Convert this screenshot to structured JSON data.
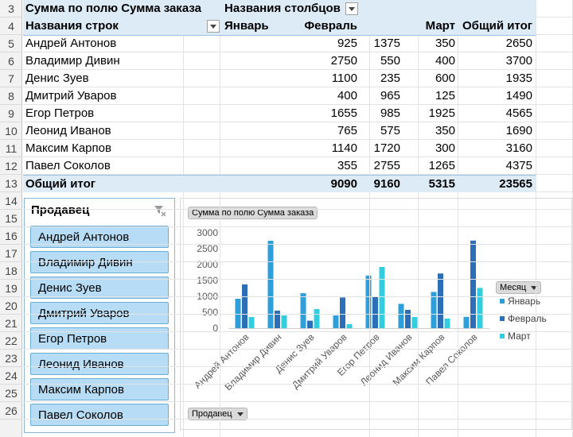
{
  "rows_visible": [
    "3",
    "4",
    "5",
    "6",
    "7",
    "8",
    "9",
    "10",
    "11",
    "12",
    "13",
    "14",
    "15",
    "16",
    "17",
    "18",
    "19",
    "20",
    "21",
    "22",
    "23",
    "24",
    "25",
    "26"
  ],
  "pivot": {
    "values_field": "Сумма по полю Сумма заказа",
    "column_labels": "Названия столбцов",
    "row_labels": "Названия строк",
    "columns": [
      "Январь",
      "Февраль",
      "Март",
      "Общий итог"
    ],
    "rows": [
      {
        "name": "Андрей Антонов",
        "values": [
          "925",
          "1375",
          "350",
          "2650"
        ]
      },
      {
        "name": "Владимир Дивин",
        "values": [
          "2750",
          "550",
          "400",
          "3700"
        ]
      },
      {
        "name": "Денис Зуев",
        "values": [
          "1100",
          "235",
          "600",
          "1935"
        ]
      },
      {
        "name": "Дмитрий Уваров",
        "values": [
          "400",
          "965",
          "125",
          "1490"
        ]
      },
      {
        "name": "Егор Петров",
        "values": [
          "1655",
          "985",
          "1925",
          "4565"
        ]
      },
      {
        "name": "Леонид Иванов",
        "values": [
          "765",
          "575",
          "350",
          "1690"
        ]
      },
      {
        "name": "Максим Карпов",
        "values": [
          "1140",
          "1720",
          "300",
          "3160"
        ]
      },
      {
        "name": "Павел Соколов",
        "values": [
          "355",
          "2755",
          "1265",
          "4375"
        ]
      }
    ],
    "total": {
      "name": "Общий итог",
      "values": [
        "9090",
        "9160",
        "5315",
        "23565"
      ]
    }
  },
  "slicer": {
    "title": "Продавец",
    "items": [
      "Андрей Антонов",
      "Владимир Дивин",
      "Денис Зуев",
      "Дмитрий Уваров",
      "Егор Петров",
      "Леонид Иванов",
      "Максим Карпов",
      "Павел Соколов"
    ]
  },
  "chart": {
    "values_button": "Сумма по полю Сумма заказа",
    "axis_button": "Продавец",
    "legend_button": "Месяц"
  },
  "colors": {
    "jan": "#2e9fd9",
    "feb": "#2d6fb6",
    "mar": "#33cde0",
    "band": "#ddebf7",
    "slicer_item": "#b7dcf5"
  },
  "chart_data": {
    "type": "bar",
    "categories": [
      "Андрей Антонов",
      "Владимир Дивин",
      "Денис Зуев",
      "Дмитрий Уваров",
      "Егор Петров",
      "Леонид Иванов",
      "Максим Карпов",
      "Павел Соколов"
    ],
    "series": [
      {
        "name": "Январь",
        "values": [
          925,
          2750,
          1100,
          400,
          1655,
          765,
          1140,
          355
        ]
      },
      {
        "name": "Февраль",
        "values": [
          1375,
          550,
          235,
          965,
          985,
          575,
          1720,
          2755
        ]
      },
      {
        "name": "Март",
        "values": [
          350,
          400,
          600,
          125,
          1925,
          350,
          300,
          1265
        ]
      }
    ],
    "yticks": [
      "0",
      "500",
      "1000",
      "1500",
      "2000",
      "2500",
      "3000"
    ],
    "ylim": [
      0,
      3000
    ],
    "legend": "right",
    "grid": false
  }
}
